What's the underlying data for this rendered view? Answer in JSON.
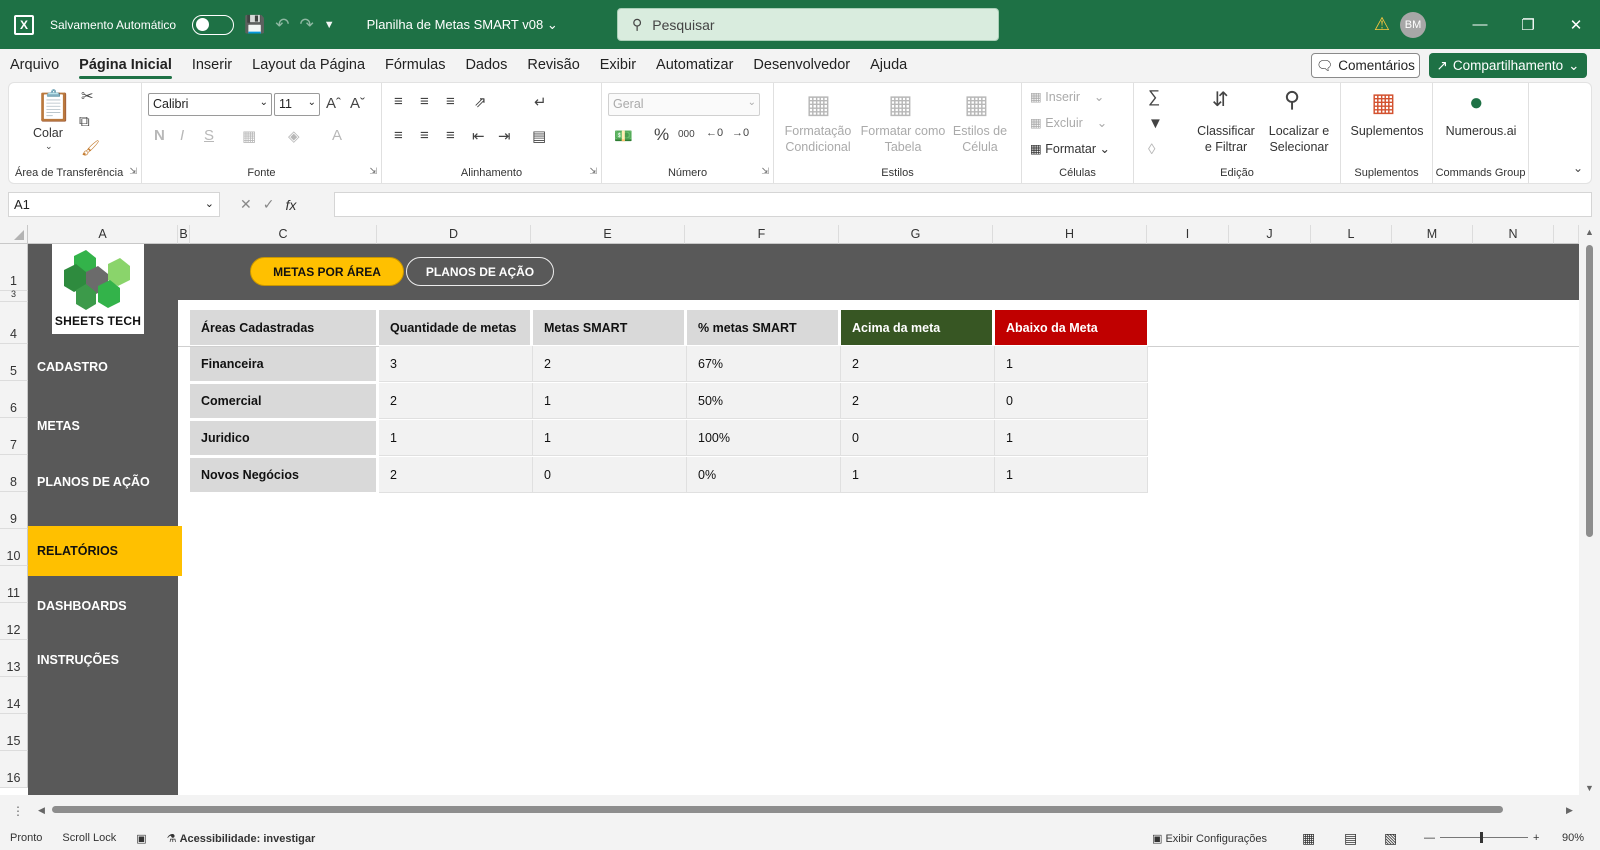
{
  "titlebar": {
    "autosave_label": "Salvamento Automático",
    "doc_title": "Planilha de Metas SMART v08",
    "search_placeholder": "Pesquisar",
    "avatar": "BM"
  },
  "menu": {
    "items": [
      "Arquivo",
      "Página Inicial",
      "Inserir",
      "Layout da Página",
      "Fórmulas",
      "Dados",
      "Revisão",
      "Exibir",
      "Automatizar",
      "Desenvolvedor",
      "Ajuda"
    ],
    "active": "Página Inicial",
    "comments": "Comentários",
    "share": "Compartilhamento"
  },
  "ribbon": {
    "clipboard": {
      "paste": "Colar",
      "label": "Área de Transferência"
    },
    "font": {
      "name": "Calibri",
      "size": "11",
      "label": "Fonte"
    },
    "alignment": {
      "label": "Alinhamento"
    },
    "number": {
      "format": "Geral",
      "label": "Número",
      "percent": "%",
      "thousands": "000"
    },
    "styles": {
      "cond_format": [
        "Formatação",
        "Condicional"
      ],
      "format_table": [
        "Formatar como",
        "Tabela"
      ],
      "cell_styles": [
        "Estilos de",
        "Célula"
      ],
      "label": "Estilos"
    },
    "cells": {
      "insert": "Inserir",
      "delete": "Excluir",
      "format": "Formatar",
      "label": "Células"
    },
    "editing": {
      "sort": [
        "Classificar",
        "e Filtrar"
      ],
      "find": [
        "Localizar e",
        "Selecionar"
      ],
      "label": "Edição"
    },
    "addins": {
      "name": "Suplementos",
      "label": "Suplementos"
    },
    "commands": {
      "name": "Numerous.ai",
      "label": "Commands Group"
    }
  },
  "formula_bar": {
    "name_box": "A1",
    "formula": ""
  },
  "columns": [
    "A",
    "B",
    "C",
    "D",
    "E",
    "F",
    "G",
    "H",
    "I",
    "J",
    "L",
    "M",
    "N"
  ],
  "rows": [
    "1",
    "3",
    "4",
    "5",
    "6",
    "7",
    "8",
    "9",
    "10",
    "11",
    "12",
    "13",
    "14",
    "15",
    "16"
  ],
  "dashboard": {
    "logo_text": "SHEETS TECH",
    "tabs": {
      "active": "METAS POR ÁREA",
      "inactive": "PLANOS DE AÇÃO"
    },
    "nav": [
      "CADASTRO",
      "METAS",
      "PLANOS DE AÇÃO",
      "RELATÓRIOS",
      "DASHBOARDS",
      "INSTRUÇÕES"
    ],
    "nav_active": "RELATÓRIOS",
    "colors": {
      "band": "#595959",
      "accent": "#ffc000",
      "above": "#375623",
      "below": "#c00000",
      "excel_green": "#1e7145"
    }
  },
  "table": {
    "headers": [
      "Áreas Cadastradas",
      "Quantidade de metas",
      "Metas SMART",
      "% metas SMART",
      "Acima da meta",
      "Abaixo da Meta"
    ],
    "rows": [
      [
        "Financeira",
        "3",
        "2",
        "67%",
        "2",
        "1"
      ],
      [
        "Comercial",
        "2",
        "1",
        "50%",
        "2",
        "0"
      ],
      [
        "Juridico",
        "1",
        "1",
        "100%",
        "0",
        "1"
      ],
      [
        "Novos Negócios",
        "2",
        "0",
        "0%",
        "1",
        "1"
      ]
    ]
  },
  "statusbar": {
    "ready": "Pronto",
    "scroll_lock": "Scroll Lock",
    "accessibility": "Acessibilidade: investigar",
    "display_settings": "Exibir Configurações",
    "zoom": "90%"
  }
}
